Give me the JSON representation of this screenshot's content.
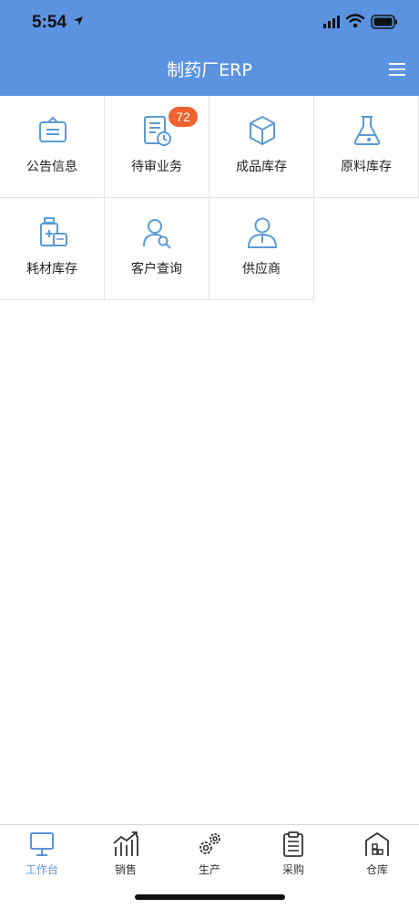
{
  "status": {
    "time": "5:54"
  },
  "header": {
    "title": "制药厂ERP",
    "menu_icon": "hamburger-icon"
  },
  "colors": {
    "accent": "#5b93e0",
    "badge": "#f0622f",
    "icon": "#5a9bd5"
  },
  "grid": [
    {
      "label": "公告信息",
      "icon": "notice-board-icon"
    },
    {
      "label": "待审业务",
      "icon": "pending-document-icon",
      "badge": "72"
    },
    {
      "label": "成品库存",
      "icon": "box-icon"
    },
    {
      "label": "原料库存",
      "icon": "flask-icon"
    },
    {
      "label": "耗材库存",
      "icon": "medicine-icon"
    },
    {
      "label": "客户查询",
      "icon": "customer-search-icon"
    },
    {
      "label": "供应商",
      "icon": "supplier-person-icon"
    }
  ],
  "tabs": [
    {
      "label": "工作台",
      "icon": "monitor-icon",
      "active": true
    },
    {
      "label": "销售",
      "icon": "sales-chart-icon",
      "active": false
    },
    {
      "label": "生产",
      "icon": "gears-icon",
      "active": false
    },
    {
      "label": "采购",
      "icon": "clipboard-icon",
      "active": false
    },
    {
      "label": "仓库",
      "icon": "warehouse-icon",
      "active": false
    }
  ]
}
